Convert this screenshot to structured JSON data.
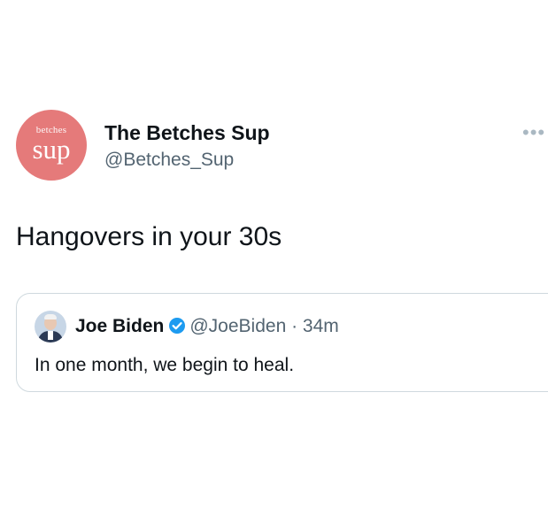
{
  "tweet": {
    "avatar": {
      "small_text": "betches",
      "big_text": "sup",
      "color": "#e57a7a"
    },
    "display_name": "The Betches Sup",
    "handle": "@Betches_Sup",
    "more_icon": "more-horizontal-icon",
    "text": "Hangovers in your 30s"
  },
  "quoted_tweet": {
    "display_name": "Joe Biden",
    "verified": true,
    "verified_icon": "verified-badge-icon",
    "verified_color": "#1d9bf0",
    "handle": "@JoeBiden",
    "separator": "·",
    "time": "34m",
    "text": "In one month, we begin to heal."
  }
}
